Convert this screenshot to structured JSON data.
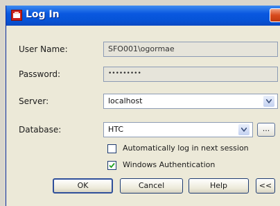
{
  "window": {
    "title": "Log In",
    "close_icon": "close-icon",
    "app_icon": "app-icon"
  },
  "form": {
    "user_name_label": "User Name:",
    "user_name_value": "SFO001\\ogormae",
    "password_label": "Password:",
    "password_value": "•••••••••",
    "server_label": "Server:",
    "server_value": "localhost",
    "database_label": "Database:",
    "database_value": "HTC",
    "browse_label": "...",
    "auto_login_label": "Automatically log in next session",
    "auto_login_checked": false,
    "windows_auth_label": "Windows Authentication",
    "windows_auth_checked": true
  },
  "buttons": {
    "ok": "OK",
    "cancel": "Cancel",
    "help": "Help",
    "collapse": "<<"
  },
  "colors": {
    "titlebar": "#0a58e0",
    "window_bg": "#ece9d8",
    "close_button": "#d84a1c"
  }
}
